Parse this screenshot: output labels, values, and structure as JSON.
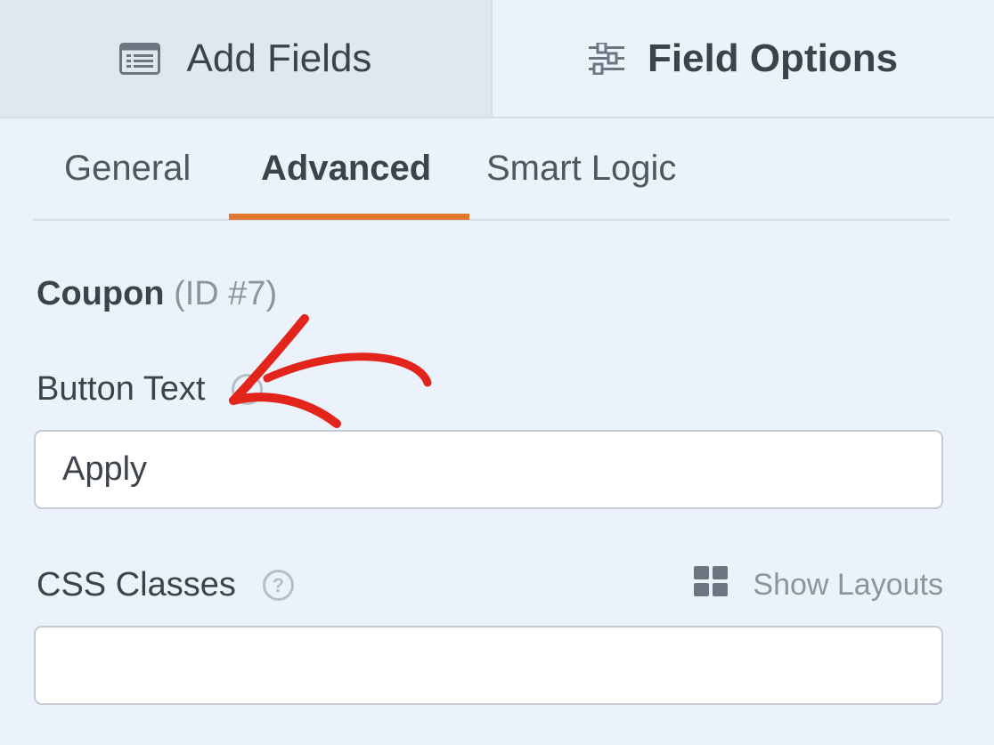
{
  "top_tabs": {
    "add_fields": {
      "label": "Add Fields",
      "icon": "list-icon"
    },
    "field_options": {
      "label": "Field Options",
      "icon": "sliders-icon"
    }
  },
  "sub_tabs": [
    "General",
    "Advanced",
    "Smart Logic"
  ],
  "active_sub_tab": "Advanced",
  "field": {
    "name": "Coupon",
    "id_text": "(ID #7)"
  },
  "button_text": {
    "label": "Button Text",
    "value": "Apply",
    "help_icon": "question-icon"
  },
  "css_classes": {
    "label": "CSS Classes",
    "value": "",
    "help_icon": "question-icon",
    "show_layouts_label": "Show Layouts",
    "show_layouts_icon": "grid-icon"
  },
  "colors": {
    "background": "#ebf2fb",
    "active_tab_underline": "#e27730",
    "annotation_arrow": "#e3241b"
  }
}
